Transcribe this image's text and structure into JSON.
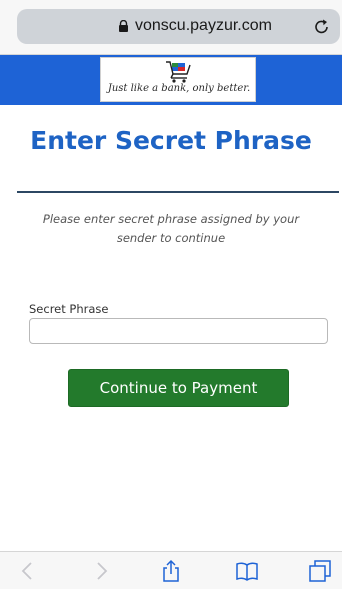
{
  "browser": {
    "url": "vonscu.payzur.com",
    "lock_icon": "lock-icon",
    "reload_icon": "reload-icon",
    "accent": "#1e63d6"
  },
  "brand": {
    "tagline": "Just like a bank, only better.",
    "logo_icon": "shopping-cart-icon"
  },
  "main": {
    "title": "Enter Secret Phrase",
    "instructions": "Please enter secret phrase assigned by your sender to continue",
    "field_label": "Secret Phrase",
    "field_value": "",
    "button_label": "Continue to Payment",
    "button_color": "#237a2c"
  },
  "toolbar": {
    "icons": [
      "back-icon",
      "forward-icon",
      "share-icon",
      "bookmarks-icon",
      "tabs-icon"
    ]
  }
}
